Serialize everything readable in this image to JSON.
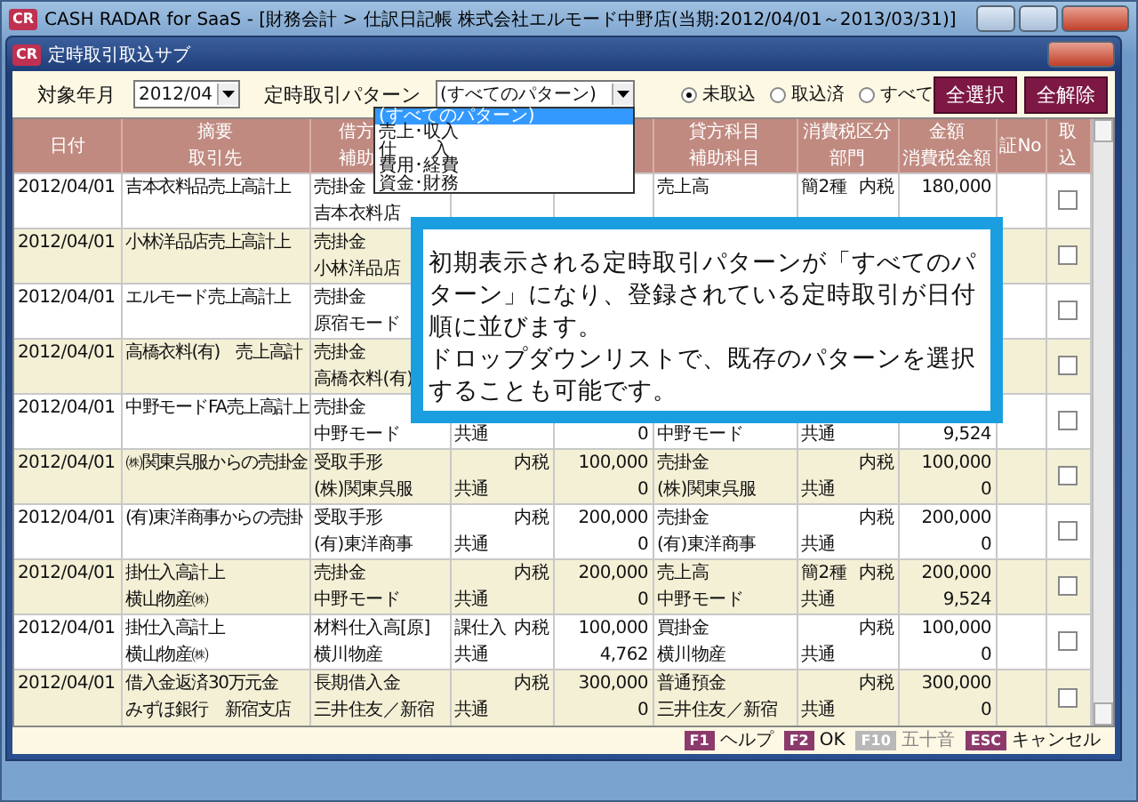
{
  "app_window": {
    "logo": "CR",
    "title": "CASH RADAR for SaaS - [財務会計 > 仕訳日記帳 株式会社エルモード中野店(当期:2012/04/01～2013/03/31)]"
  },
  "dialog": {
    "logo": "CR",
    "title": "定時取引取込サブ"
  },
  "filter": {
    "month_label": "対象年月",
    "month": "2012/04",
    "pattern_label": "定時取引パターン",
    "pattern": "(すべてのパターン)",
    "pattern_options": [
      {
        "label": "(すべてのパターン)",
        "selected": true
      },
      {
        "label": "売上･収入",
        "selected": false
      },
      {
        "label": "仕　　入",
        "selected": false
      },
      {
        "label": "費用･経費",
        "selected": false
      },
      {
        "label": "資金･財務",
        "selected": false
      }
    ],
    "radios": [
      {
        "label": "未取込",
        "selected": true
      },
      {
        "label": "取込済",
        "selected": false
      },
      {
        "label": "すべて",
        "selected": false
      }
    ],
    "buttons": [
      "全選択",
      "全解除"
    ]
  },
  "table": {
    "columns": [
      {
        "top": "日付"
      },
      {
        "top": "摘要",
        "bottom": "取引先"
      },
      {
        "top": "借方",
        "bottom": "補助"
      },
      {},
      {},
      {
        "top": "貸方科目",
        "bottom": "補助科目"
      },
      {
        "top": "消費税区分",
        "bottom": "部門"
      },
      {
        "top": "金額",
        "bottom": "消費税金額"
      },
      {
        "top": "証No"
      },
      {
        "top": "取",
        "bottom": "込"
      }
    ],
    "rows": [
      {
        "date": "2012/04/01",
        "summary": "吉本衣料品売上高計上",
        "debit": {
          "account": "売掛金",
          "sub": "吉本衣料店"
        },
        "credit": {
          "account": "売上高",
          "tax_type": "簡2種",
          "tax_mode": "内税",
          "amount": "180,000"
        },
        "checked": false
      },
      {
        "date": "2012/04/01",
        "summary": "小林洋品店売上高計上",
        "debit": {
          "account": "売掛金",
          "sub": "小林洋品店"
        },
        "credit": {},
        "checked": false
      },
      {
        "date": "2012/04/01",
        "summary": "エルモード売上高計上",
        "debit": {
          "account": "売掛金",
          "sub": "原宿モード"
        },
        "credit": {},
        "checked": false
      },
      {
        "date": "2012/04/01",
        "summary": "高橋衣料(有)　売上高計",
        "debit": {
          "account": "売掛金",
          "sub": "高橋衣料(有)"
        },
        "credit": {},
        "checked": false
      },
      {
        "date": "2012/04/01",
        "summary": "中野モードFA売上高計上",
        "debit": {
          "account": "売掛金",
          "sub": "中野モード",
          "dept": "共通",
          "tax_amount": "0"
        },
        "credit": {
          "sub": "中野モード",
          "dept": "共通",
          "tax_amount": "9,524"
        },
        "checked": false
      },
      {
        "date": "2012/04/01",
        "summary": "㈱関東呉服からの売掛金",
        "debit": {
          "account": "受取手形",
          "sub": "(株)関東呉服",
          "tax_mode": "内税",
          "dept": "共通",
          "amount": "100,000",
          "tax_amount": "0"
        },
        "credit": {
          "account": "売掛金",
          "sub": "(株)関東呉服",
          "tax_mode": "内税",
          "dept": "共通",
          "amount": "100,000",
          "tax_amount": "0"
        },
        "checked": false
      },
      {
        "date": "2012/04/01",
        "summary": "(有)東洋商事からの売掛",
        "debit": {
          "account": "受取手形",
          "sub": "(有)東洋商事",
          "tax_mode": "内税",
          "dept": "共通",
          "amount": "200,000",
          "tax_amount": "0"
        },
        "credit": {
          "account": "売掛金",
          "sub": "(有)東洋商事",
          "tax_mode": "内税",
          "dept": "共通",
          "amount": "200,000",
          "tax_amount": "0"
        },
        "checked": false
      },
      {
        "date": "2012/04/01",
        "summary": "掛仕入高計上",
        "partner": "横山物産㈱",
        "debit": {
          "account": "売掛金",
          "sub": "中野モード",
          "tax_mode": "内税",
          "dept": "共通",
          "amount": "200,000",
          "tax_amount": "0"
        },
        "credit": {
          "account": "売上高",
          "sub": "中野モード",
          "tax_type": "簡2種",
          "tax_mode": "内税",
          "dept": "共通",
          "amount": "200,000",
          "tax_amount": "9,524"
        },
        "checked": false
      },
      {
        "date": "2012/04/01",
        "summary": "掛仕入高計上",
        "partner": "横山物産㈱",
        "debit": {
          "account": "材料仕入高[原]",
          "sub": "横川物産",
          "tax_type": "課仕入",
          "tax_mode": "内税",
          "dept": "共通",
          "amount": "100,000",
          "tax_amount": "4,762"
        },
        "credit": {
          "account": "買掛金",
          "sub": "横川物産",
          "tax_mode": "内税",
          "dept": "共通",
          "amount": "100,000",
          "tax_amount": "0"
        },
        "checked": false
      },
      {
        "date": "2012/04/01",
        "summary": "借入金返済30万元金",
        "partner": "みずほ銀行　新宿支店",
        "debit": {
          "account": "長期借入金",
          "sub": "三井住友／新宿",
          "tax_mode": "内税",
          "dept": "共通",
          "amount": "300,000",
          "tax_amount": "0"
        },
        "credit": {
          "account": "普通預金",
          "sub": "三井住友／新宿",
          "tax_mode": "内税",
          "dept": "共通",
          "amount": "300,000",
          "tax_amount": "0"
        },
        "checked": false
      }
    ]
  },
  "callout": [
    "初期表示される定時取引パターンが「すべてのパターン」になり、登録されている定時取引が日付順に並びます。",
    "ドロップダウンリストで、既存のパターンを選択することも可能です。"
  ],
  "function_keys": [
    {
      "key": "F1",
      "label": "ヘルプ",
      "disabled": false
    },
    {
      "key": "F2",
      "label": "OK",
      "disabled": false
    },
    {
      "key": "F10",
      "label": "五十音",
      "disabled": true
    },
    {
      "key": "ESC",
      "label": "キャンセル",
      "disabled": false
    }
  ]
}
